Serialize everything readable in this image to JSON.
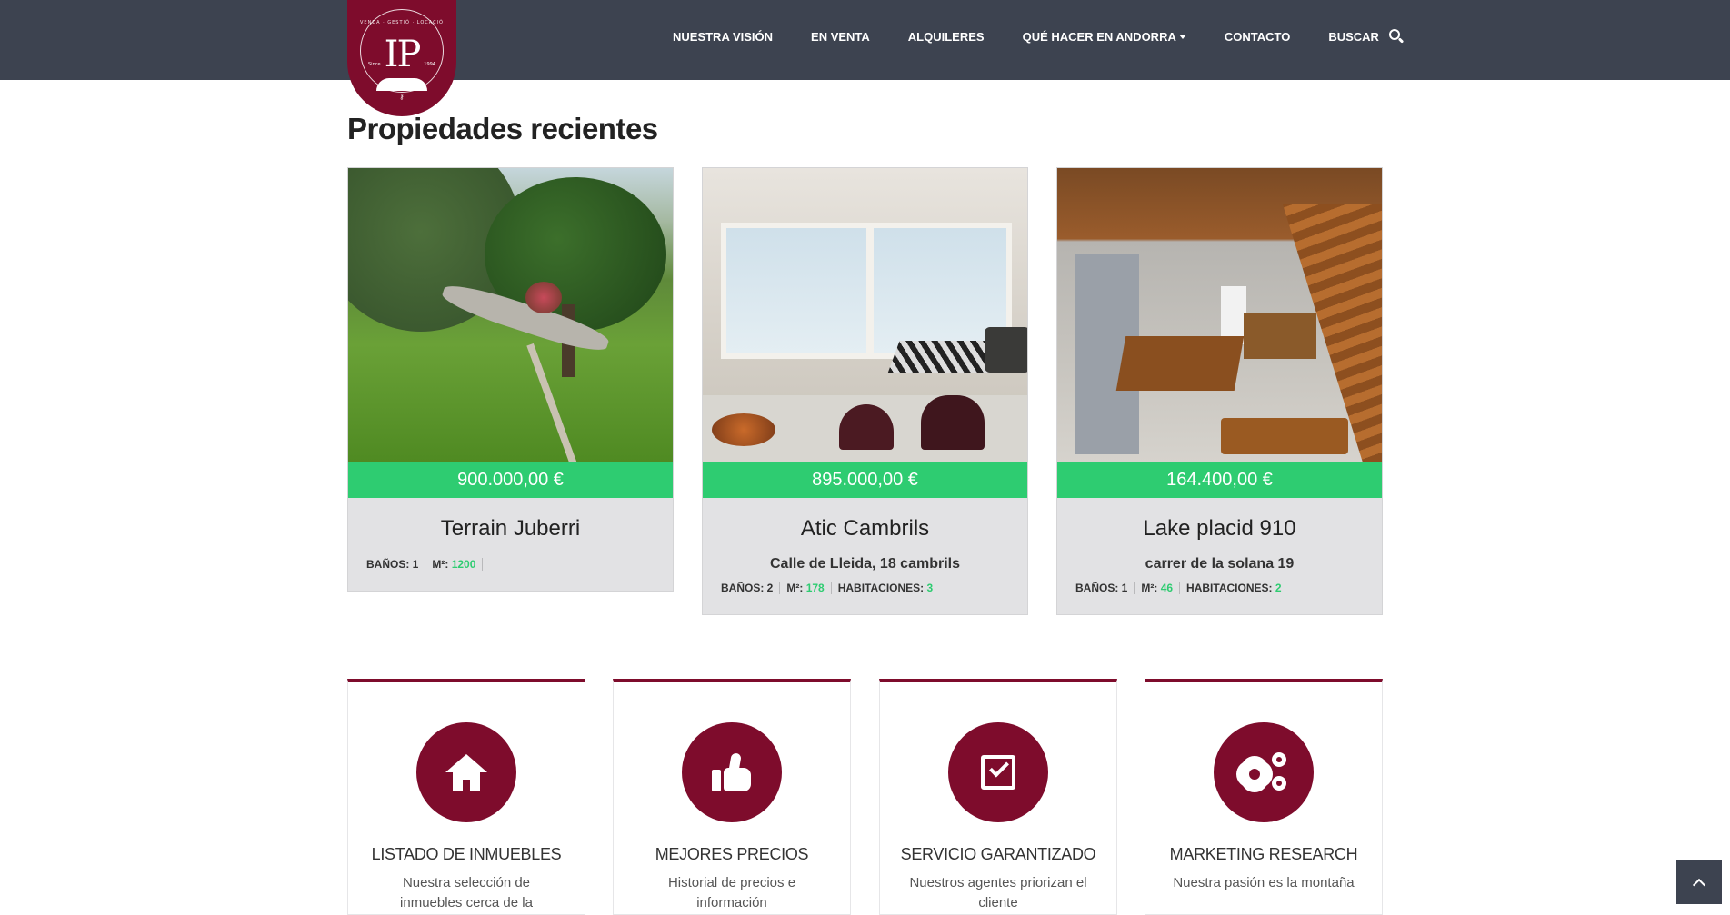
{
  "logo": {
    "monogram": "IP",
    "tagline": "VENDA · GESTIÓ · LOCACIÓ",
    "since_label": "Since",
    "since_year": "1994"
  },
  "nav": {
    "items": [
      {
        "label": "NUESTRA VISIÓN"
      },
      {
        "label": "EN VENTA"
      },
      {
        "label": "ALQUILERES"
      },
      {
        "label": "QUÉ HACER EN ANDORRA"
      },
      {
        "label": "CONTACTO"
      },
      {
        "label": "BUSCAR"
      }
    ]
  },
  "recent": {
    "title": "Propiedades recientes",
    "properties": [
      {
        "price": "900.000,00 €",
        "title": "Terrain Juberri",
        "address": "",
        "specs": [
          {
            "label": "BAÑOS: 1",
            "value": ""
          },
          {
            "label": "M²:",
            "value": "1200"
          }
        ]
      },
      {
        "price": "895.000,00 €",
        "title": "Atic Cambrils",
        "address": "Calle de Lleida, 18 cambrils",
        "specs": [
          {
            "label": "BAÑOS: 2",
            "value": ""
          },
          {
            "label": "M²:",
            "value": "178"
          },
          {
            "label": "HABITACIONES:",
            "value": "3"
          }
        ]
      },
      {
        "price": "164.400,00 €",
        "title": "Lake placid 910",
        "address": "carrer de la solana 19",
        "specs": [
          {
            "label": "BAÑOS: 1",
            "value": ""
          },
          {
            "label": "M²:",
            "value": "46"
          },
          {
            "label": "HABITACIONES:",
            "value": "2"
          }
        ]
      }
    ]
  },
  "features": [
    {
      "icon": "house-icon",
      "title": "LISTADO DE INMUEBLES",
      "text": "Nuestra selección de inmuebles cerca de la"
    },
    {
      "icon": "thumbs-up-icon",
      "title": "MEJORES PRECIOS",
      "text": "Historial de precios e información"
    },
    {
      "icon": "check-square-icon",
      "title": "SERVICIO GARANTIZADO",
      "text": "Nuestros agentes priorizan el cliente"
    },
    {
      "icon": "gears-icon",
      "title": "MARKETING RESEARCH",
      "text": "Nuestra pasión es la montaña"
    }
  ],
  "colors": {
    "header": "#3d4350",
    "brand": "#7e0c2c",
    "price": "#2ecc71",
    "card": "#e2e2e4"
  }
}
